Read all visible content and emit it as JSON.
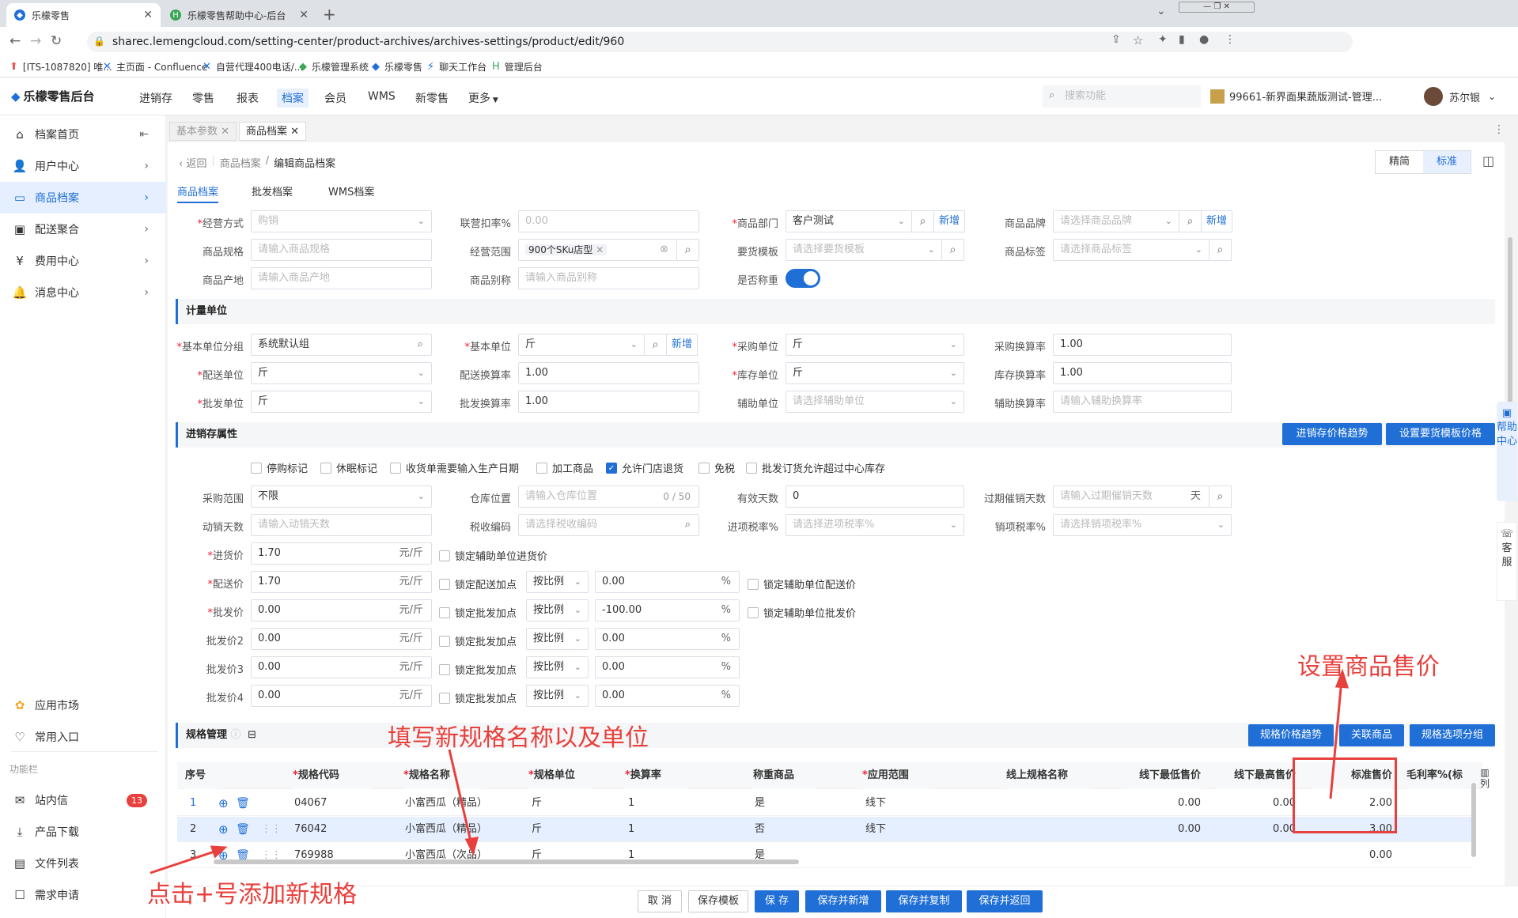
{
  "browser": {
    "tabs": [
      {
        "title": "乐檬零售"
      },
      {
        "title": "乐檬零售帮助中心-后台"
      }
    ],
    "url": "sharec.lemengcloud.com/setting-center/product-archives/archives-settings/product/edit/960",
    "bookmarks": [
      "[ITS-1087820] 唯...",
      "主页面 - Confluence",
      "自营代理400电话/...",
      "乐檬管理系统",
      "乐檬零售",
      "聊天工作台",
      "管理后台"
    ]
  },
  "app": {
    "logo": "乐檬零售后台",
    "nav": [
      "进销存",
      "零售",
      "报表",
      "档案",
      "会员",
      "WMS",
      "新零售",
      "更多"
    ],
    "active_nav": "档案",
    "search_placeholder": "搜索功能",
    "store": "99661-新界面果蔬版测试-管理...",
    "user": "苏尔银"
  },
  "sidebar": {
    "items": [
      {
        "label": "档案首页",
        "icon": "home-icon"
      },
      {
        "label": "用户中心",
        "icon": "user-icon"
      },
      {
        "label": "商品档案",
        "icon": "archive-icon"
      },
      {
        "label": "配送聚合",
        "icon": "delivery-icon"
      },
      {
        "label": "费用中心",
        "icon": "fee-icon"
      },
      {
        "label": "消息中心",
        "icon": "bell-icon"
      }
    ],
    "bottom": [
      {
        "label": "应用市场"
      },
      {
        "label": "常用入口"
      }
    ],
    "section": "功能栏",
    "func": [
      {
        "label": "站内信",
        "badge": "13"
      },
      {
        "label": "产品下载"
      },
      {
        "label": "文件列表"
      },
      {
        "label": "需求申请"
      }
    ]
  },
  "pagetabs": [
    "基本参数",
    "商品档案"
  ],
  "breadcrumb": {
    "back": "返回",
    "parent": "商品档案",
    "current": "编辑商品档案"
  },
  "view_toggle": [
    "精简",
    "标准"
  ],
  "subtabs": [
    "商品档案",
    "批发档案",
    "WMS档案"
  ],
  "basic": {
    "jyfs_label": "经营方式",
    "jyfs_value": "购销",
    "lykl_label": "联营扣率%",
    "lykl_value": "0.00",
    "spbm_label": "商品部门",
    "spbm_value": "客户测试",
    "add": "新增",
    "sppp_label": "商品品牌",
    "sppp_ph": "请选择商品品牌",
    "spgg_label": "商品规格",
    "spgg_ph": "请输入商品规格",
    "jyfw_label": "经营范围",
    "jyfw_tag": "900个SKu店型",
    "yhmb_label": "要货模板",
    "yhmb_ph": "请选择要货模板",
    "spbq_label": "商品标签",
    "spbq_ph": "请选择商品标签",
    "spcd_label": "商品产地",
    "spcd_ph": "请输入商品产地",
    "spbm2_label": "商品别称",
    "spbm2_ph": "请输入商品别称",
    "sfcz_label": "是否称重"
  },
  "unit": {
    "title": "计量单位",
    "jbdwfz_label": "基本单位分组",
    "jbdwfz_value": "系统默认组",
    "jbdw_label": "基本单位",
    "jbdw_value": "斤",
    "cgdw_label": "采购单位",
    "cgdw_value": "斤",
    "cghsl_label": "采购换算率",
    "cghsl_value": "1.00",
    "psdw_label": "配送单位",
    "psdw_value": "斤",
    "pshsl_label": "配送换算率",
    "pshsl_value": "1.00",
    "kcdw_label": "库存单位",
    "kcdw_value": "斤",
    "kchsl_label": "库存换算率",
    "kchsl_value": "1.00",
    "pfdw_label": "批发单位",
    "pfdw_value": "斤",
    "pfhsl_label": "批发换算率",
    "pfhsl_value": "1.00",
    "fzdw_label": "辅助单位",
    "fzdw_ph": "请选择辅助单位",
    "fzhsl_label": "辅助换算率",
    "fzhsl_ph": "请输入辅助换算率"
  },
  "jxc": {
    "title": "进销存属性",
    "btn_trend": "进销存价格趋势",
    "btn_tpl": "设置要货模板价格",
    "checks": [
      {
        "label": "停购标记",
        "on": false
      },
      {
        "label": "休眠标记",
        "on": false
      },
      {
        "label": "收货单需要输入生产日期",
        "on": false
      },
      {
        "label": "加工商品",
        "on": false
      },
      {
        "label": "允许门店退货",
        "on": true
      },
      {
        "label": "免税",
        "on": false
      },
      {
        "label": "批发订货允许超过中心库存",
        "on": false
      }
    ],
    "cgfw_label": "采购范围",
    "cgfw_value": "不限",
    "ckwz_label": "仓库位置",
    "ckwz_ph": "请输入仓库位置",
    "ckwz_count": "0 / 50",
    "yxts_label": "有效天数",
    "yxts_value": "0",
    "gqcx_label": "过期催销天数",
    "gqcx_ph": "请输入过期催销天数",
    "gqcx_unit": "天",
    "dxts_label": "动销天数",
    "dxts_ph": "请输入动销天数",
    "ssbm_label": "税收编码",
    "ssbm_ph": "请选择税收编码",
    "jxsl_label": "进项税率%",
    "jxsl_ph": "请选择进项税率%",
    "xxsl_label": "销项税率%",
    "xxsl_ph": "请选择销项税率%",
    "price_unit": "元/斤",
    "prices": [
      {
        "label": "进货价",
        "req": true,
        "value": "1.70",
        "lock": "锁定辅助单位进货价",
        "hasmode": false
      },
      {
        "label": "配送价",
        "req": true,
        "value": "1.70",
        "lock": "锁定配送加点",
        "mode": "按比例",
        "pct": "0.00",
        "lock2": "锁定辅助单位配送价",
        "hasmode": true
      },
      {
        "label": "批发价",
        "req": true,
        "value": "0.00",
        "lock": "锁定批发加点",
        "mode": "按比例",
        "pct": "-100.00",
        "lock2": "锁定辅助单位批发价",
        "hasmode": true
      },
      {
        "label": "批发价2",
        "req": false,
        "value": "0.00",
        "lock": "锁定批发加点",
        "mode": "按比例",
        "pct": "0.00",
        "hasmode": true
      },
      {
        "label": "批发价3",
        "req": false,
        "value": "0.00",
        "lock": "锁定批发加点",
        "mode": "按比例",
        "pct": "0.00",
        "hasmode": true
      },
      {
        "label": "批发价4",
        "req": false,
        "value": "0.00",
        "lock": "锁定批发加点",
        "mode": "按比例",
        "pct": "0.00",
        "hasmode": true
      }
    ]
  },
  "spec": {
    "title": "规格管理",
    "btns": [
      "规格价格趋势",
      "关联商品",
      "规格选项分组"
    ],
    "headers": [
      "序号",
      "规格代码",
      "规格名称",
      "规格单位",
      "换算率",
      "称重商品",
      "应用范围",
      "线上规格名称",
      "线下最低售价",
      "线下最高售价",
      "标准售价",
      "毛利率%(标"
    ],
    "col_more": "列",
    "rows": [
      {
        "no": "1",
        "code": "04067",
        "name": "小富西瓜（精品）",
        "unit": "斤",
        "rate": "1",
        "weigh": "是",
        "scope": "线下",
        "min": "0.00",
        "max": "0.00",
        "std": "2.00"
      },
      {
        "no": "2",
        "code": "76042",
        "name": "小富西瓜（精品）",
        "unit": "斤",
        "rate": "1",
        "weigh": "否",
        "scope": "线下",
        "min": "0.00",
        "max": "0.00",
        "std": "3.00"
      },
      {
        "no": "3",
        "code": "769988",
        "name": "小富西瓜（次品）",
        "unit": "斤",
        "rate": "1",
        "weigh": "是",
        "scope": "",
        "min": "",
        "max": "",
        "std": "0.00"
      }
    ]
  },
  "footer": [
    "取 消",
    "保存模板",
    "保 存",
    "保存并新增",
    "保存并复制",
    "保存并返回"
  ],
  "help": {
    "help_text": "帮助中心",
    "service": "客服"
  },
  "annotations": {
    "a1": "设置商品售价",
    "a2": "填写新规格名称以及单位",
    "a3": "点击+号添加新规格"
  }
}
